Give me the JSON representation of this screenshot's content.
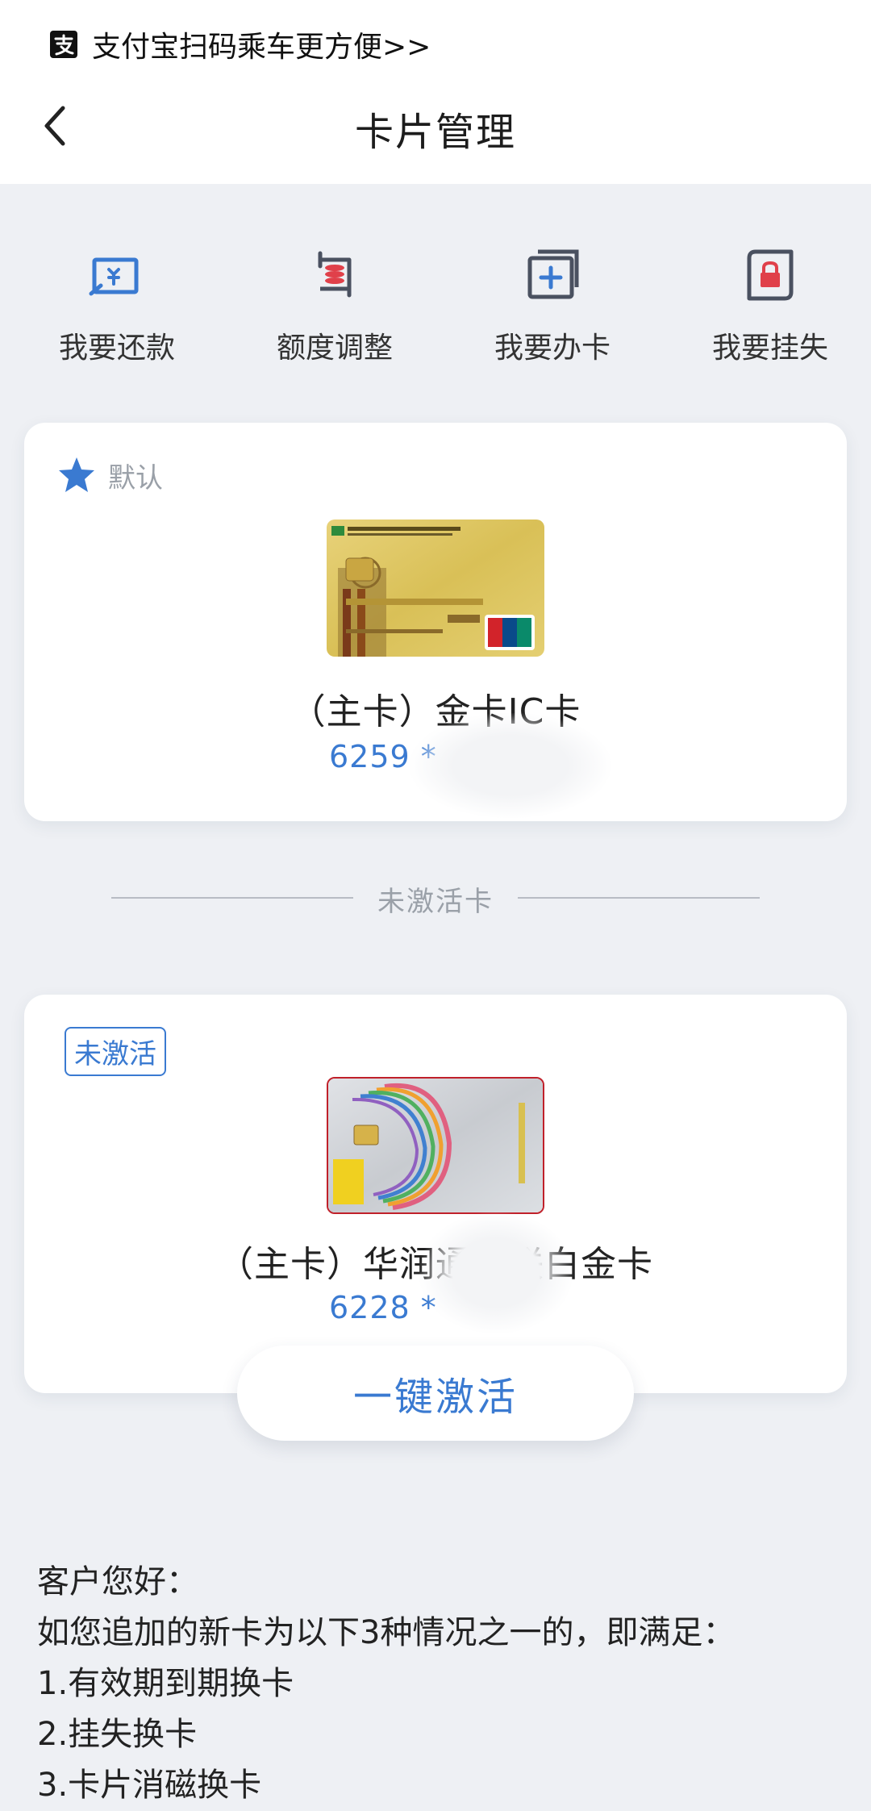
{
  "alipay_bar": {
    "icon": "alipay-icon",
    "text": "支付宝扫码乘车更方便>>"
  },
  "nav": {
    "title": "卡片管理",
    "back_icon": "chevron-left-icon"
  },
  "actions": [
    {
      "label": "我要还款",
      "icon": "repay-icon"
    },
    {
      "label": "额度调整",
      "icon": "limit-adjust-icon"
    },
    {
      "label": "我要办卡",
      "icon": "apply-card-icon"
    },
    {
      "label": "我要挂失",
      "icon": "report-loss-icon"
    }
  ],
  "cards": [
    {
      "tag": "默认",
      "tag_icon": "star-icon",
      "name": "（主卡）金卡IC卡",
      "number": "6259 *"
    },
    {
      "tag": "未激活",
      "name": "（主卡）华润通银联白金卡",
      "number": "6228 *"
    }
  ],
  "divider_label": "未激活卡",
  "activate_button": "一键激活",
  "notice": {
    "lines": [
      "客户您好：",
      "如您追加的新卡为以下3种情况之一的，即满足：",
      "1.有效期到期换卡",
      "2.挂失换卡",
      "3.卡片消磁换卡"
    ]
  },
  "colors": {
    "accent": "#3a7ad1",
    "background": "#eef0f4",
    "danger": "#e0404a"
  }
}
